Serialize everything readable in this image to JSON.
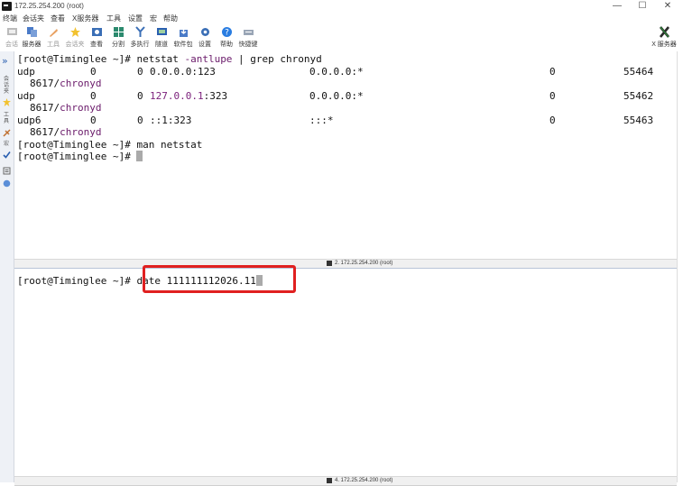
{
  "window": {
    "title": "172.25.254.200 (root)",
    "min_glyph": "—",
    "max_glyph": "☐",
    "close_glyph": "✕"
  },
  "menu": [
    "终端",
    "会话夹",
    "查看",
    "X服务器",
    "工具",
    "设置",
    "宏",
    "帮助"
  ],
  "toolbar": [
    {
      "label": "会话",
      "icon": "session-icon",
      "enabled": false
    },
    {
      "label": "服务器",
      "icon": "servers-icon",
      "enabled": true
    },
    {
      "label": "工具",
      "icon": "tools-icon",
      "enabled": false
    },
    {
      "label": "会话夹",
      "icon": "star-icon",
      "enabled": false
    },
    {
      "label": "查看",
      "icon": "view-icon",
      "enabled": true
    },
    {
      "label": "分割",
      "icon": "split-icon",
      "enabled": true
    },
    {
      "label": "多执行",
      "icon": "multiexec-icon",
      "enabled": true
    },
    {
      "label": "隧道",
      "icon": "tunnel-icon",
      "enabled": true
    },
    {
      "label": "软件包",
      "icon": "packages-icon",
      "enabled": true
    },
    {
      "label": "设置",
      "icon": "settings-icon",
      "enabled": true
    },
    {
      "label": "帮助",
      "icon": "help-icon",
      "enabled": true
    },
    {
      "label": "快捷键",
      "icon": "keyboard-icon",
      "enabled": true
    }
  ],
  "xserver": {
    "label": "X 服务器"
  },
  "sidebar": {
    "tab1": "会话夹",
    "tab2": "工具",
    "tab3": "宏"
  },
  "pane1": {
    "prompt": "[root@Timinglee ~]#",
    "cmd1": " netstat ",
    "cmd1_opt": "-antlupe",
    "cmd1_rest": " | grep chronyd",
    "rows": [
      {
        "proto": "udp",
        "recv": "0",
        "send": "0",
        "local_pre": "0.0.0.0:123",
        "local_hl": "",
        "local_post": "",
        "foreign": "0.0.0.0:*",
        "user": "0",
        "inode": "55464",
        "prog_pre": "8617/",
        "prog": "chronyd"
      },
      {
        "proto": "udp",
        "recv": "0",
        "send": "0",
        "local_pre": "",
        "local_hl": "127.0.0.1",
        "local_post": ":323",
        "foreign": "0.0.0.0:*",
        "user": "0",
        "inode": "55462",
        "prog_pre": "8617/",
        "prog": "chronyd"
      },
      {
        "proto": "udp6",
        "recv": "0",
        "send": "0",
        "local_pre": "::1:323",
        "local_hl": "",
        "local_post": "",
        "foreign": ":::*",
        "user": "0",
        "inode": "55463",
        "prog_pre": "8617/",
        "prog": "chronyd"
      }
    ],
    "cmd2": " man netstat",
    "tab_title": "2. 172.25.254.200 (root)"
  },
  "pane2": {
    "prompt": "[root@Timinglee ~]#",
    "cmd": " date 111111112026.11",
    "tab_title": "4. 172.25.254.200 (root)"
  },
  "colors": {
    "highlight": "#e02020",
    "accent": "#2a5fb0",
    "purple": "#6a1a6a"
  }
}
